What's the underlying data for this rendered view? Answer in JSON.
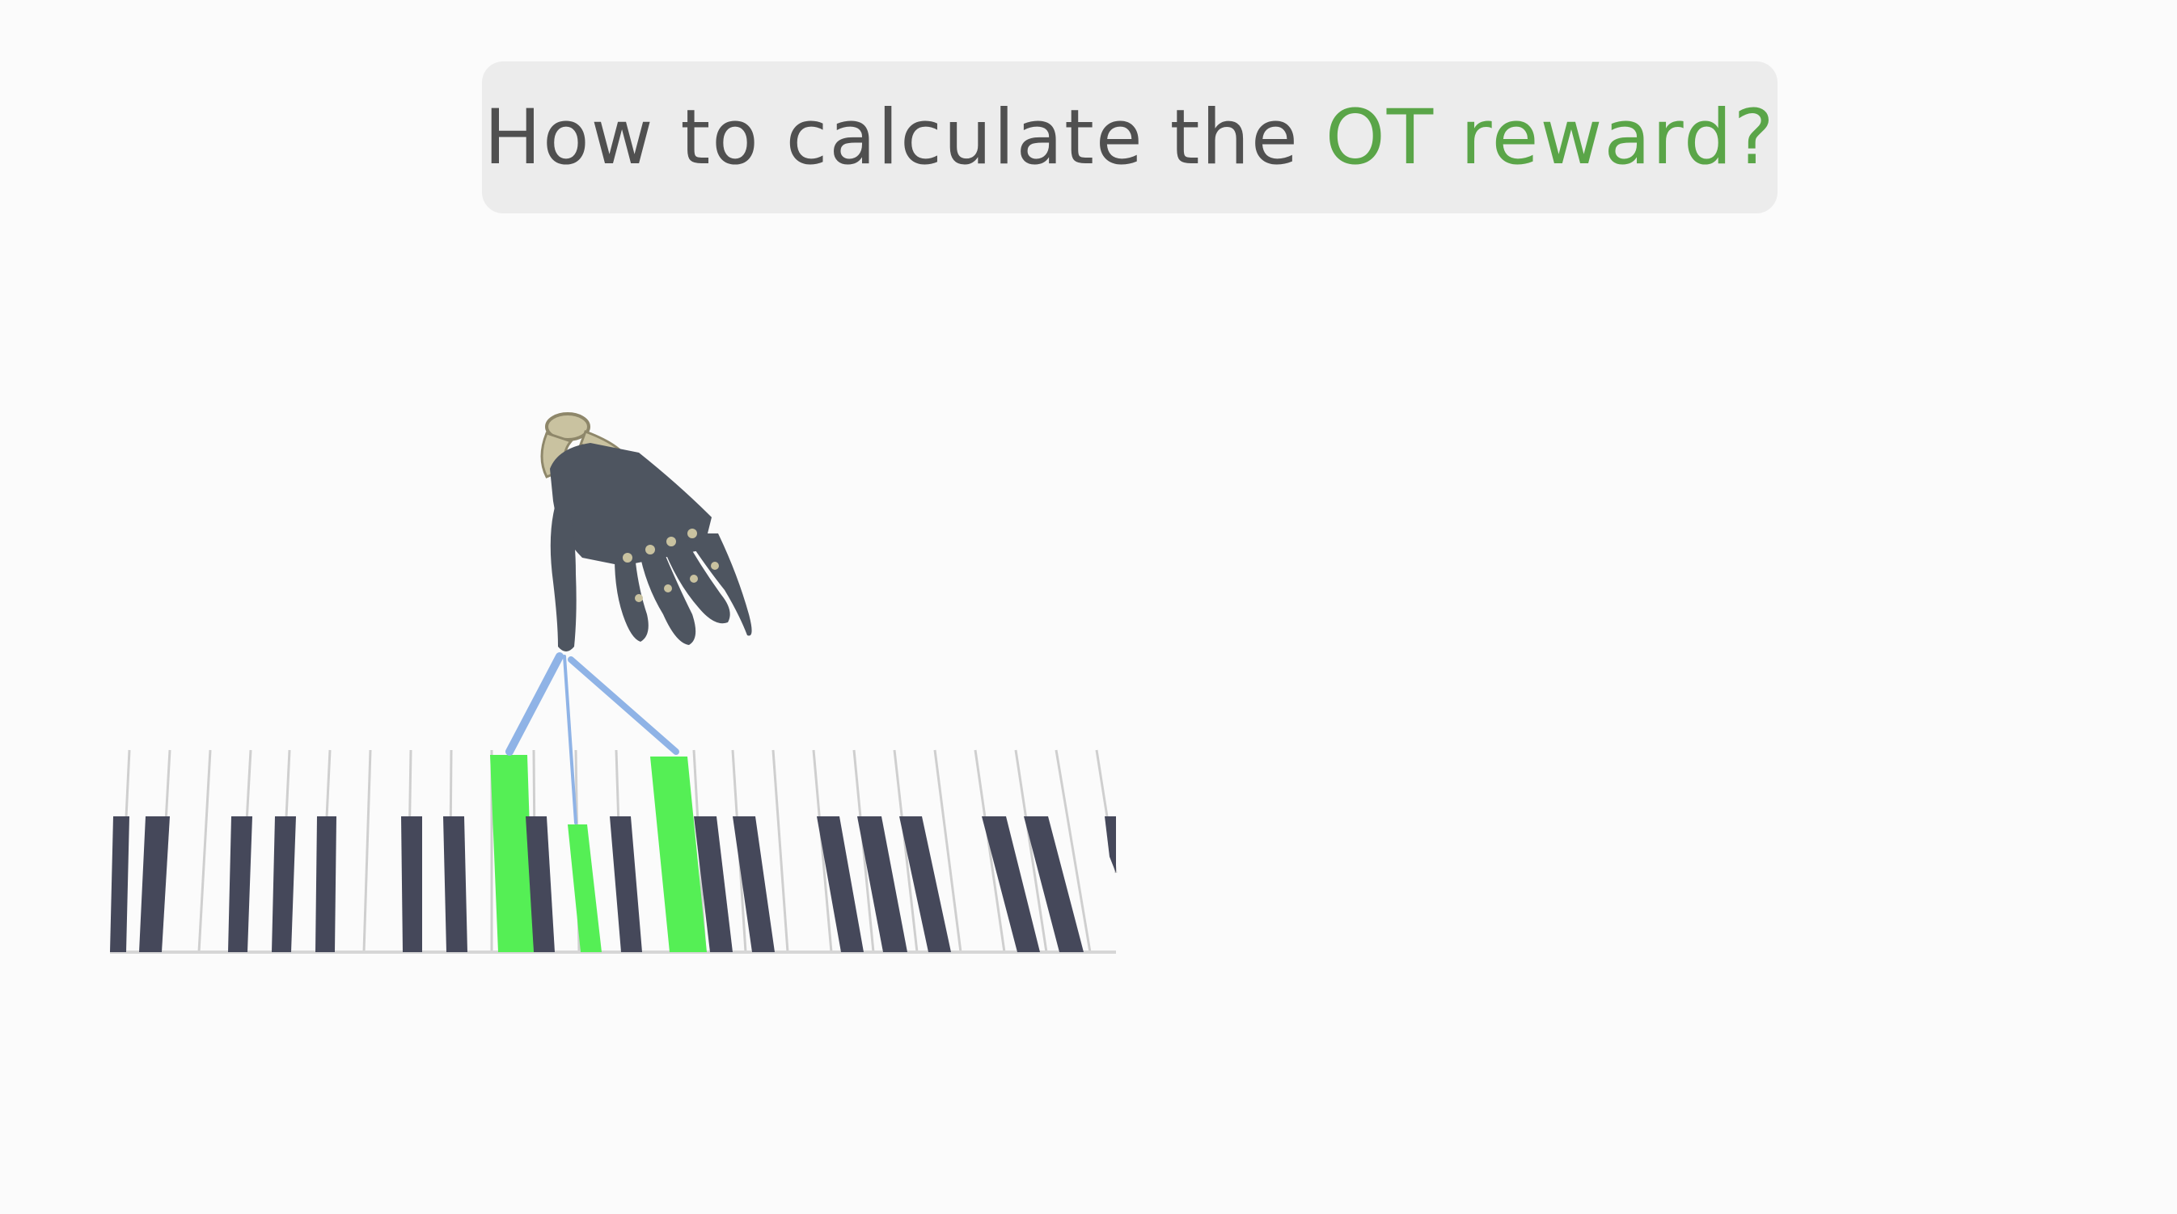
{
  "title": {
    "prefix": "How to calculate the ",
    "highlight": "OT reward?"
  },
  "colors": {
    "background": "#fbfbfb",
    "title_box": "#ececec",
    "title_text": "#505050",
    "accent": "#5aa548",
    "pressed_key": "#55ef55",
    "black_key": "#45485a",
    "hand": "#4e5560",
    "hand_joint": "#c9c2a0",
    "link_line": "#8fb3e6"
  },
  "icons": {
    "robot_hand": "robot-hand-icon",
    "piano_keyboard": "piano-keyboard"
  }
}
